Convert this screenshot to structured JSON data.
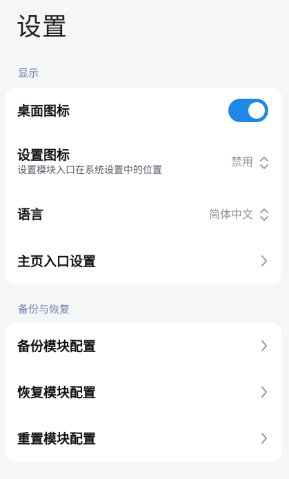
{
  "header": {
    "title": "设置"
  },
  "sections": [
    {
      "title": "显示",
      "items": [
        {
          "title": "桌面图标",
          "control": "toggle",
          "toggle_on": true
        },
        {
          "title": "设置图标",
          "subtitle": "设置模块入口在系统设置中的位置",
          "control": "select",
          "value": "禁用"
        },
        {
          "title": "语言",
          "control": "select",
          "value": "简体中文"
        },
        {
          "title": "主页入口设置",
          "control": "chevron"
        }
      ]
    },
    {
      "title": "备份与恢复",
      "items": [
        {
          "title": "备份模块配置",
          "control": "chevron"
        },
        {
          "title": "恢复模块配置",
          "control": "chevron"
        },
        {
          "title": "重置模块配置",
          "control": "chevron"
        }
      ]
    }
  ],
  "icons": {
    "select": "up-down-chevron-icon",
    "chevron": "chevron-right-icon"
  },
  "colors": {
    "accent": "#1e88e5",
    "section_title": "#6b7db3",
    "background": "#f5f6f8",
    "card": "#ffffff"
  }
}
